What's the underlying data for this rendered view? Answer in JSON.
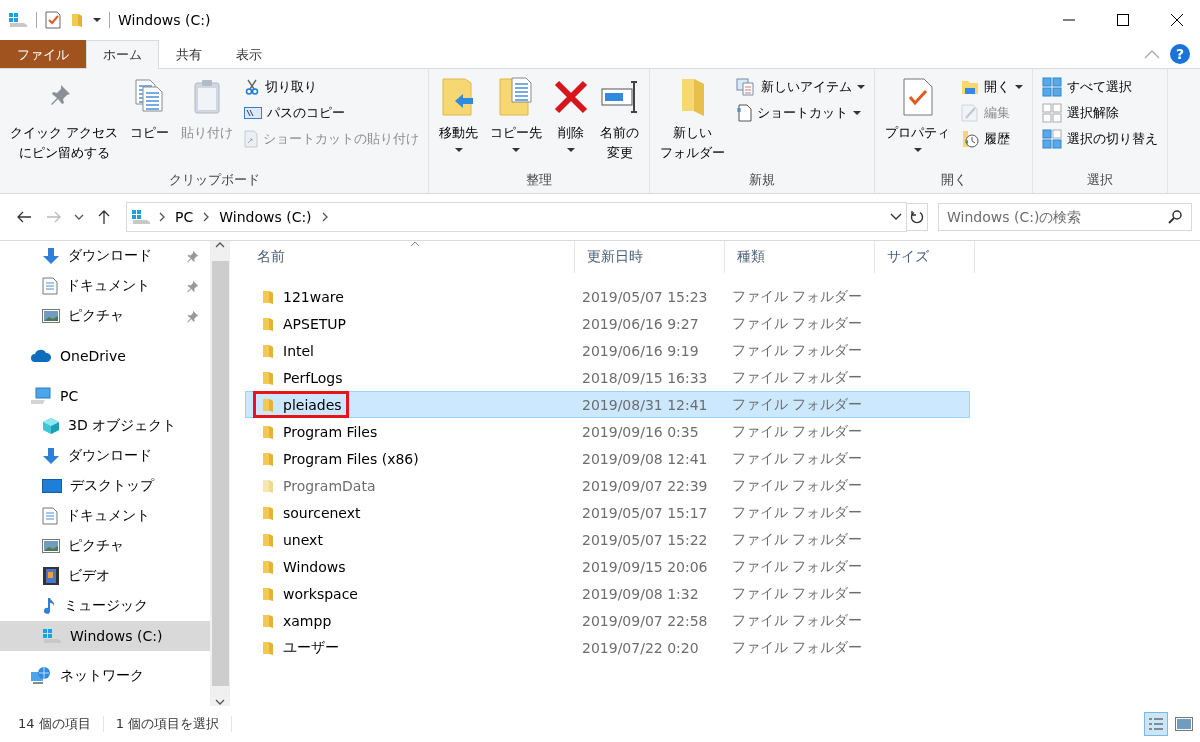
{
  "window": {
    "title": "Windows (C:)"
  },
  "ribbon": {
    "tabs": [
      {
        "label": "ファイル",
        "kind": "file",
        "selected": false
      },
      {
        "label": "ホーム",
        "kind": "tab",
        "selected": true
      },
      {
        "label": "共有",
        "kind": "tab",
        "selected": false
      },
      {
        "label": "表示",
        "kind": "tab",
        "selected": false
      }
    ],
    "help": "?",
    "groups": [
      {
        "label": "クリップボード",
        "items": [
          {
            "lines": [
              "クイック アクセス",
              "にピン留めする"
            ],
            "kind": "large",
            "disabled": false,
            "dropdown": false
          },
          {
            "lines": [
              "コピー"
            ],
            "kind": "large",
            "disabled": false,
            "dropdown": false
          },
          {
            "lines": [
              "貼り付け"
            ],
            "kind": "large",
            "disabled": true,
            "dropdown": false
          },
          {
            "label": "切り取り",
            "kind": "small",
            "disabled": false,
            "dropdown": false
          },
          {
            "label": "パスのコピー",
            "kind": "small",
            "disabled": false,
            "dropdown": false
          },
          {
            "label": "ショートカットの貼り付け",
            "kind": "small",
            "disabled": true,
            "dropdown": false
          }
        ]
      },
      {
        "label": "整理",
        "items": [
          {
            "lines": [
              "移動先"
            ],
            "kind": "large",
            "disabled": false,
            "dropdown": true
          },
          {
            "lines": [
              "コピー先"
            ],
            "kind": "large",
            "disabled": false,
            "dropdown": true
          },
          {
            "lines": [
              "削除"
            ],
            "kind": "large",
            "disabled": false,
            "dropdown": true
          },
          {
            "lines": [
              "名前の",
              "変更"
            ],
            "kind": "large",
            "disabled": false,
            "dropdown": false
          }
        ]
      },
      {
        "label": "新規",
        "items": [
          {
            "lines": [
              "新しい",
              "フォルダー"
            ],
            "kind": "large",
            "disabled": false,
            "dropdown": false
          },
          {
            "label": "新しいアイテム",
            "kind": "small",
            "disabled": false,
            "dropdown": true
          },
          {
            "label": "ショートカット",
            "kind": "small",
            "disabled": false,
            "dropdown": true
          }
        ]
      },
      {
        "label": "開く",
        "items": [
          {
            "lines": [
              "プロパティ"
            ],
            "kind": "large",
            "disabled": false,
            "dropdown": true
          },
          {
            "label": "開く",
            "kind": "small",
            "disabled": false,
            "dropdown": true
          },
          {
            "label": "編集",
            "kind": "small",
            "disabled": true,
            "dropdown": false
          },
          {
            "label": "履歴",
            "kind": "small",
            "disabled": false,
            "dropdown": false
          }
        ]
      },
      {
        "label": "選択",
        "items": [
          {
            "label": "すべて選択",
            "kind": "small",
            "disabled": false,
            "dropdown": false
          },
          {
            "label": "選択解除",
            "kind": "small",
            "disabled": false,
            "dropdown": false
          },
          {
            "label": "選択の切り替え",
            "kind": "small",
            "disabled": false,
            "dropdown": false
          }
        ]
      }
    ]
  },
  "address_bar": {
    "path": [
      "PC",
      "Windows (C:)"
    ],
    "search": {
      "placeholder": "Windows (C:)の検索"
    }
  },
  "sidebar": {
    "quick_access": [
      {
        "label": "ダウンロード",
        "pinned": true,
        "selected": false
      },
      {
        "label": "ドキュメント",
        "pinned": true,
        "selected": false
      },
      {
        "label": "ピクチャ",
        "pinned": true,
        "selected": false
      }
    ],
    "items": [
      {
        "label": "OneDrive",
        "selected": false
      },
      {
        "label": "PC",
        "selected": false,
        "children": [
          {
            "label": "3D オブジェクト",
            "selected": false
          },
          {
            "label": "ダウンロード",
            "selected": false
          },
          {
            "label": "デスクトップ",
            "selected": false
          },
          {
            "label": "ドキュメント",
            "selected": false
          },
          {
            "label": "ピクチャ",
            "selected": false
          },
          {
            "label": "ビデオ",
            "selected": false
          },
          {
            "label": "ミュージック",
            "selected": false
          },
          {
            "label": "Windows (C:)",
            "selected": true
          }
        ]
      },
      {
        "label": "ネットワーク",
        "selected": false
      }
    ]
  },
  "files": {
    "columns": [
      {
        "label": "名前",
        "sorted": true
      },
      {
        "label": "更新日時",
        "sorted": false
      },
      {
        "label": "種類",
        "sorted": false
      },
      {
        "label": "サイズ",
        "sorted": false
      }
    ],
    "rows": [
      {
        "name": "121ware",
        "modified": "2019/05/07 15:23",
        "type": "ファイル フォルダー",
        "selected": false,
        "hidden": false,
        "annotated": false
      },
      {
        "name": "APSETUP",
        "modified": "2019/06/16 9:27",
        "type": "ファイル フォルダー",
        "selected": false,
        "hidden": false,
        "annotated": false
      },
      {
        "name": "Intel",
        "modified": "2019/06/16 9:19",
        "type": "ファイル フォルダー",
        "selected": false,
        "hidden": false,
        "annotated": false
      },
      {
        "name": "PerfLogs",
        "modified": "2018/09/15 16:33",
        "type": "ファイル フォルダー",
        "selected": false,
        "hidden": false,
        "annotated": false
      },
      {
        "name": "pleiades",
        "modified": "2019/08/31 12:41",
        "type": "ファイル フォルダー",
        "selected": true,
        "hidden": false,
        "annotated": true
      },
      {
        "name": "Program Files",
        "modified": "2019/09/16 0:35",
        "type": "ファイル フォルダー",
        "selected": false,
        "hidden": false,
        "annotated": false
      },
      {
        "name": "Program Files (x86)",
        "modified": "2019/09/08 12:41",
        "type": "ファイル フォルダー",
        "selected": false,
        "hidden": false,
        "annotated": false
      },
      {
        "name": "ProgramData",
        "modified": "2019/09/07 22:39",
        "type": "ファイル フォルダー",
        "selected": false,
        "hidden": true,
        "annotated": false
      },
      {
        "name": "sourcenext",
        "modified": "2019/05/07 15:17",
        "type": "ファイル フォルダー",
        "selected": false,
        "hidden": false,
        "annotated": false
      },
      {
        "name": "unext",
        "modified": "2019/05/07 15:22",
        "type": "ファイル フォルダー",
        "selected": false,
        "hidden": false,
        "annotated": false
      },
      {
        "name": "Windows",
        "modified": "2019/09/15 20:06",
        "type": "ファイル フォルダー",
        "selected": false,
        "hidden": false,
        "annotated": false
      },
      {
        "name": "workspace",
        "modified": "2019/09/08 1:32",
        "type": "ファイル フォルダー",
        "selected": false,
        "hidden": false,
        "annotated": false
      },
      {
        "name": "xampp",
        "modified": "2019/09/07 22:58",
        "type": "ファイル フォルダー",
        "selected": false,
        "hidden": false,
        "annotated": false
      },
      {
        "name": "ユーザー",
        "modified": "2019/07/22 0:20",
        "type": "ファイル フォルダー",
        "selected": false,
        "hidden": false,
        "annotated": false
      }
    ]
  },
  "status_bar": {
    "item_count": "14 個の項目",
    "selection": "1 個の項目を選択",
    "views": [
      {
        "kind": "details",
        "selected": true
      },
      {
        "kind": "large_icons",
        "selected": false
      }
    ]
  }
}
